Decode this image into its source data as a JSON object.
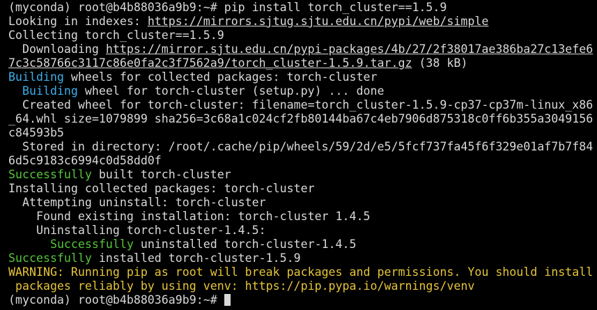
{
  "terminal": {
    "prompt": "(myconda) root@b4b88036a9b9:~# ",
    "command": "pip install torch_cluster==1.5.9",
    "looking_prefix": "Looking in indexes: ",
    "index_url": "https://mirrors.sjtug.sjtu.edu.cn/pypi/web/simple",
    "collecting": "Collecting torch_cluster==1.5.9",
    "downloading_prefix": "  Downloading ",
    "download_url_part1": "https://mirror.sjtu.edu.cn/pypi-packages/4b/27/2f38017ae386ba27c13efe6",
    "download_url_part2": "7c3c58766c3117c86e0fa2c3f7562a9/torch_cluster-1.5.9.tar.gz",
    "download_size": " (38 kB)",
    "building_label": "Building",
    "building_rest": " wheels for collected packages: torch-cluster",
    "building_indent": "  ",
    "building_wheel_label": "Building",
    "building_wheel_rest": " wheel for torch-cluster (setup.py) ... done",
    "created_wheel_1": "  Created wheel for torch-cluster: filename=torch_cluster-1.5.9-cp37-cp37m-linux_x86",
    "created_wheel_2": "_64.whl size=1079899 sha256=3c68a1c024cf2fb80144ba67c4eb7906d875318c0ff6b355a3049156",
    "created_wheel_3": "c84593b5",
    "stored_1": "  Stored in directory: /root/.cache/pip/wheels/59/2d/e5/5fcf737fa45f6f329e01af7b7f84",
    "stored_2": "6d5c9183c6994c0d58dd0f",
    "success_label": "Successfully",
    "built_rest": " built torch-cluster",
    "installing": "Installing collected packages: torch-cluster",
    "attempting": "  Attempting uninstall: torch-cluster",
    "found_existing": "    Found existing installation: torch-cluster 1.4.5",
    "uninstalling": "    Uninstalling torch-cluster-1.4.5:",
    "uninstalled_indent": "      ",
    "uninstalled_rest": " uninstalled torch-cluster-1.4.5",
    "installed_rest": " installed torch-cluster-1.5.9",
    "warning_1": "WARNING: Running pip as root will break packages and permissions. You should install",
    "warning_2": " packages reliably by using venv: https://pip.pypa.io/warnings/venv",
    "final_prompt": "(myconda) root@b4b88036a9b9:~# ",
    "colors": {
      "background": "#000000",
      "text": "#d8d8d8",
      "building": "#3daee9",
      "success": "#55c43a",
      "warning": "#e5c53a"
    }
  }
}
